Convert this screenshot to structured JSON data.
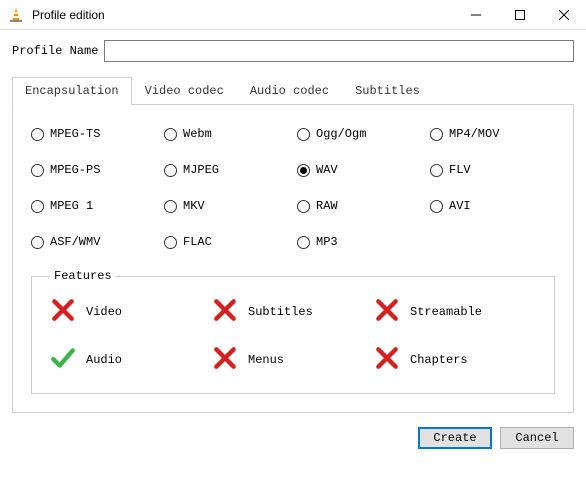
{
  "window": {
    "title": "Profile edition"
  },
  "profile": {
    "label": "Profile Name",
    "value": ""
  },
  "tabs": [
    {
      "label": "Encapsulation",
      "active": true
    },
    {
      "label": "Video codec",
      "active": false
    },
    {
      "label": "Audio codec",
      "active": false
    },
    {
      "label": "Subtitles",
      "active": false
    }
  ],
  "encapsulation": {
    "options": [
      {
        "label": "MPEG-TS",
        "selected": false
      },
      {
        "label": "Webm",
        "selected": false
      },
      {
        "label": "Ogg/Ogm",
        "selected": false
      },
      {
        "label": "MP4/MOV",
        "selected": false
      },
      {
        "label": "MPEG-PS",
        "selected": false
      },
      {
        "label": "MJPEG",
        "selected": false
      },
      {
        "label": "WAV",
        "selected": true
      },
      {
        "label": "FLV",
        "selected": false
      },
      {
        "label": "MPEG 1",
        "selected": false
      },
      {
        "label": "MKV",
        "selected": false
      },
      {
        "label": "RAW",
        "selected": false
      },
      {
        "label": "AVI",
        "selected": false
      },
      {
        "label": "ASF/WMV",
        "selected": false
      },
      {
        "label": "FLAC",
        "selected": false
      },
      {
        "label": "MP3",
        "selected": false
      }
    ]
  },
  "features": {
    "legend": "Features",
    "items": [
      {
        "label": "Video",
        "ok": false
      },
      {
        "label": "Subtitles",
        "ok": false
      },
      {
        "label": "Streamable",
        "ok": false
      },
      {
        "label": "Audio",
        "ok": true
      },
      {
        "label": "Menus",
        "ok": false
      },
      {
        "label": "Chapters",
        "ok": false
      }
    ]
  },
  "buttons": {
    "create": "Create",
    "cancel": "Cancel"
  }
}
